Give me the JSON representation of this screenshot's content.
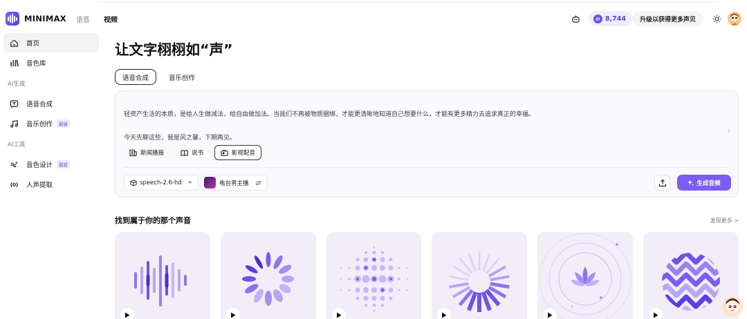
{
  "header": {
    "brand": "MINIMAX",
    "nav": [
      "语音",
      "视频"
    ],
    "credits": "8,744",
    "upgrade_label": "升级以获得更多声贝"
  },
  "sidebar": {
    "items": [
      {
        "label": "首页",
        "icon": "home-icon"
      },
      {
        "label": "音色库",
        "icon": "voice-library-icon"
      }
    ],
    "section_ai_gen": "AI生成",
    "gen_items": [
      {
        "label": "语音合成",
        "icon": "speech-synthesis-icon",
        "badge": ""
      },
      {
        "label": "音乐创作",
        "icon": "music-note-icon",
        "badge": "最新"
      }
    ],
    "section_ai_tools": "AI工具",
    "tool_items": [
      {
        "label": "音色设计",
        "icon": "voice-design-icon",
        "badge": "最新"
      },
      {
        "label": "人声提取",
        "icon": "vocal-extract-icon",
        "badge": ""
      }
    ]
  },
  "main": {
    "title": "让文字栩栩如“声”",
    "tabs": [
      "语音合成",
      "音乐创作"
    ],
    "editor": {
      "line1": "轻资产生活的本质，是给人生做减法，给自由做加法。当我们不再被物质捆绑，才能更清晰地知道自己想要什么，才能有更多精力去追求真正的幸福。",
      "line2": "今天先聊这些，我是风之馨，下期再见。",
      "chips": [
        "新闻播报",
        "说书",
        "影视配音"
      ],
      "model": "speech-2.6-hd",
      "voice": "电台男主播",
      "generate_label": "生成音频"
    },
    "section_title": "找到属于你的那个声音",
    "more_label": "发现更多 >"
  },
  "colors": {
    "accent": "#7a5ef3",
    "card_bg": "#f1eef9"
  }
}
